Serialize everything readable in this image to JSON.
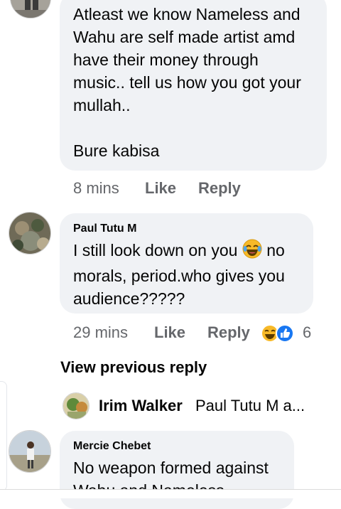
{
  "comments": [
    {
      "author": "",
      "text": "Atleast we know Nameless and\nWahu are self made artist amd\nhave their money through\nmusic.. tell us how you got your\nmullah..\n\nBure kabisa",
      "time": "8 mins",
      "like_label": "Like",
      "reply_label": "Reply"
    },
    {
      "author": "Paul Tutu M",
      "text_before_emoji": "I still look down on you",
      "emoji": "laughing-face",
      "text_after_emoji": "no\nmorals, period.who gives you\naudience?????",
      "time": "29 mins",
      "like_label": "Like",
      "reply_label": "Reply",
      "reaction_count": "6",
      "reactions": [
        "laughing-face",
        "thumbs-up"
      ]
    },
    {
      "author": "Mercie Chebet",
      "text": "No weapon formed against\nWahu and Nameless"
    }
  ],
  "view_previous_reply": "View previous reply",
  "nested_reply": {
    "author": "Irim Walker",
    "snippet": "Paul Tutu M a..."
  },
  "colors": {
    "bubble": "#f0f2f5",
    "meta_text": "#65676b",
    "text": "#050505",
    "like_blue": "#1877f2",
    "haha_yellow": "#f7b928"
  }
}
